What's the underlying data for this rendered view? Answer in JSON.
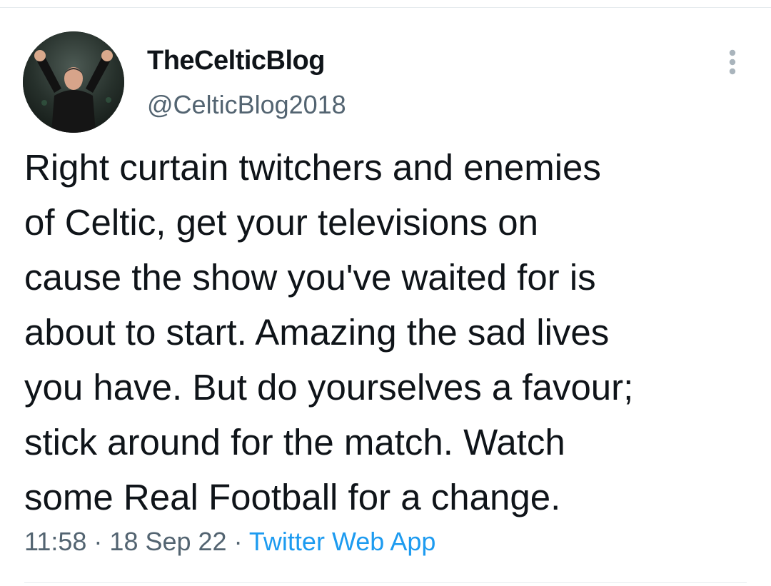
{
  "tweet": {
    "user": {
      "display_name": "TheCelticBlog",
      "handle": "@CelticBlog2018",
      "avatar_icon": "profile-photo-manager-celebrating"
    },
    "more_icon": "more-vertical-icon",
    "text": "Right curtain twitchers and enemies\nof Celtic, get your televisions on\ncause the show you've waited for is\nabout to start. Amazing the sad lives\nyou have. But do yourselves a favour;\nstick around for the match. Watch\nsome Real Football for a change.",
    "time": "11:58",
    "date": "18 Sep 22",
    "separator": " · ",
    "source": "Twitter Web App"
  },
  "colors": {
    "text_primary": "#0f1419",
    "text_secondary": "#536471",
    "link": "#1d9bf0",
    "divider": "#e6ebee"
  }
}
